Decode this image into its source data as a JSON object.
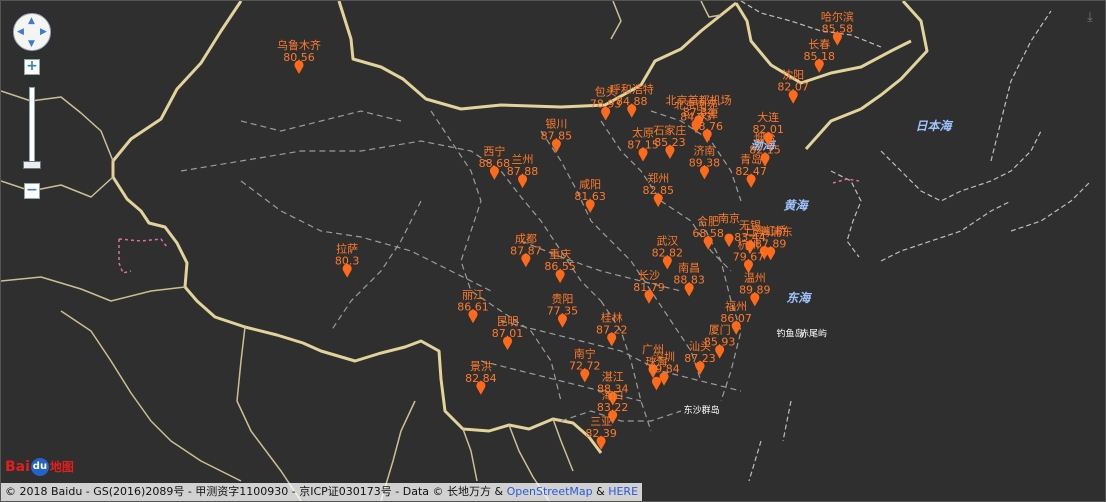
{
  "map": {
    "controls": {
      "pan_up": "▲",
      "pan_down": "▼",
      "pan_left": "◀",
      "pan_right": "▶",
      "zoom_in": "+",
      "zoom_out": "−",
      "download": "⤓"
    },
    "stations": [
      {
        "name": "哈尔滨",
        "value": "85.58",
        "lon": 126.63,
        "lat": 45.75
      },
      {
        "name": "长春",
        "value": "85.18",
        "lon": 125.32,
        "lat": 43.9
      },
      {
        "name": "乌鲁木齐",
        "value": "80.56",
        "lon": 87.62,
        "lat": 43.82
      },
      {
        "name": "沈阳",
        "value": "82.07",
        "lon": 123.43,
        "lat": 41.8
      },
      {
        "name": "包头",
        "value": "78.93",
        "lon": 109.84,
        "lat": 40.66
      },
      {
        "name": "呼和浩特",
        "value": "84.88",
        "lon": 111.73,
        "lat": 40.84
      },
      {
        "name": "北京首都机场",
        "value": "87.34",
        "lon": 116.58,
        "lat": 40.08
      },
      {
        "name": "天津",
        "value": "88.76",
        "lon": 117.2,
        "lat": 39.13
      },
      {
        "name": "北京南苑",
        "value": "84.93",
        "lon": 116.39,
        "lat": 39.78
      },
      {
        "name": "石家庄",
        "value": "85.23",
        "lon": 114.5,
        "lat": 38.04
      },
      {
        "name": "大连",
        "value": "82.01",
        "lon": 121.62,
        "lat": 38.92
      },
      {
        "name": "烟台",
        "value": "82.15",
        "lon": 121.39,
        "lat": 37.52
      },
      {
        "name": "太原",
        "value": "87.15",
        "lon": 112.55,
        "lat": 37.87
      },
      {
        "name": "银川",
        "value": "87.85",
        "lon": 106.27,
        "lat": 38.47
      },
      {
        "name": "济南",
        "value": "89.38",
        "lon": 117.0,
        "lat": 36.65
      },
      {
        "name": "青岛",
        "value": "82.47",
        "lon": 120.38,
        "lat": 36.07
      },
      {
        "name": "西宁",
        "value": "88.68",
        "lon": 101.78,
        "lat": 36.62
      },
      {
        "name": "兰州",
        "value": "87.88",
        "lon": 103.82,
        "lat": 36.06
      },
      {
        "name": "咸阳",
        "value": "81.63",
        "lon": 108.72,
        "lat": 34.36
      },
      {
        "name": "郑州",
        "value": "82.85",
        "lon": 113.65,
        "lat": 34.76
      },
      {
        "name": "上海虹桥",
        "value": "",
        "lon": 121.34,
        "lat": 31.19
      },
      {
        "name": "合肥",
        "value": "68.58",
        "lon": 117.27,
        "lat": 31.86
      },
      {
        "name": "南京",
        "value": "",
        "lon": 118.78,
        "lat": 32.04
      },
      {
        "name": "无锡",
        "value": "83.44",
        "lon": 120.3,
        "lat": 31.57
      },
      {
        "name": "成都",
        "value": "87.87",
        "lon": 104.06,
        "lat": 30.67
      },
      {
        "name": "武汉",
        "value": "82.82",
        "lon": 114.31,
        "lat": 30.52
      },
      {
        "name": "杭州",
        "value": "79.67",
        "lon": 120.19,
        "lat": 30.26
      },
      {
        "name": "上海浦东",
        "value": "87.89",
        "lon": 121.8,
        "lat": 31.14
      },
      {
        "name": "重庆",
        "value": "86.55",
        "lon": 106.54,
        "lat": 29.59
      },
      {
        "name": "拉萨",
        "value": "80.3",
        "lon": 91.11,
        "lat": 29.97
      },
      {
        "name": "南昌",
        "value": "88.83",
        "lon": 115.89,
        "lat": 28.68
      },
      {
        "name": "长沙",
        "value": "81.79",
        "lon": 112.98,
        "lat": 28.19
      },
      {
        "name": "温州",
        "value": "89.89",
        "lon": 120.65,
        "lat": 28.01
      },
      {
        "name": "丽江",
        "value": "86.61",
        "lon": 100.23,
        "lat": 26.86
      },
      {
        "name": "贵阳",
        "value": "77.35",
        "lon": 106.71,
        "lat": 26.57
      },
      {
        "name": "福州",
        "value": "86.07",
        "lon": 119.3,
        "lat": 26.08
      },
      {
        "name": "昆明",
        "value": "87.01",
        "lon": 102.73,
        "lat": 25.04
      },
      {
        "name": "桂林",
        "value": "87.22",
        "lon": 110.28,
        "lat": 25.29
      },
      {
        "name": "厦门",
        "value": "85.93",
        "lon": 118.1,
        "lat": 24.46
      },
      {
        "name": "广州",
        "value": "",
        "lon": 113.27,
        "lat": 23.13
      },
      {
        "name": "汕头",
        "value": "87.23",
        "lon": 116.68,
        "lat": 23.35
      },
      {
        "name": "南宁",
        "value": "72.72",
        "lon": 108.33,
        "lat": 22.84
      },
      {
        "name": "深圳",
        "value": "89.84",
        "lon": 114.07,
        "lat": 22.62
      },
      {
        "name": "珠海",
        "value": "",
        "lon": 113.52,
        "lat": 22.3
      },
      {
        "name": "景洪",
        "value": "82.84",
        "lon": 100.8,
        "lat": 22.0
      },
      {
        "name": "湛江",
        "value": "88.34",
        "lon": 110.36,
        "lat": 21.27
      },
      {
        "name": "海口",
        "value": "83.22",
        "lon": 110.35,
        "lat": 20.02
      },
      {
        "name": "三亚",
        "value": "82.39",
        "lon": 109.51,
        "lat": 18.25
      }
    ],
    "water_labels": [
      {
        "text": "渤海",
        "lon": 121.2,
        "lat": 38.7
      },
      {
        "text": "黄海",
        "lon": 123.6,
        "lat": 34.6
      },
      {
        "text": "东海",
        "lon": 123.8,
        "lat": 28.3
      },
      {
        "text": "日本海",
        "lon": 133.6,
        "lat": 40.0
      }
    ],
    "island_labels": [
      {
        "text": "钓鱼岛",
        "lon": 123.2,
        "lat": 25.95
      },
      {
        "text": "赤尾屿",
        "lon": 124.9,
        "lat": 25.95
      },
      {
        "text": "东沙群岛",
        "lon": 116.8,
        "lat": 20.75
      }
    ],
    "colors": {
      "background": "#2f2f2f",
      "border": "#e6d9a2",
      "province": "#9a9a9a",
      "marker": "#ff6a1a",
      "label": "#ff7a2a",
      "water": "#9ec3ff"
    }
  },
  "logo": {
    "brand_left": "Bai",
    "brand_icon": "du",
    "brand_right": "地图"
  },
  "footer": {
    "prefix": "© 2018 Baidu - GS(2016)2089号 - 甲测资字1100930 - 京ICP证030173号 - Data © 长地万方 & ",
    "osm": "OpenStreetMap",
    "amp": " & ",
    "here": "HERE"
  }
}
